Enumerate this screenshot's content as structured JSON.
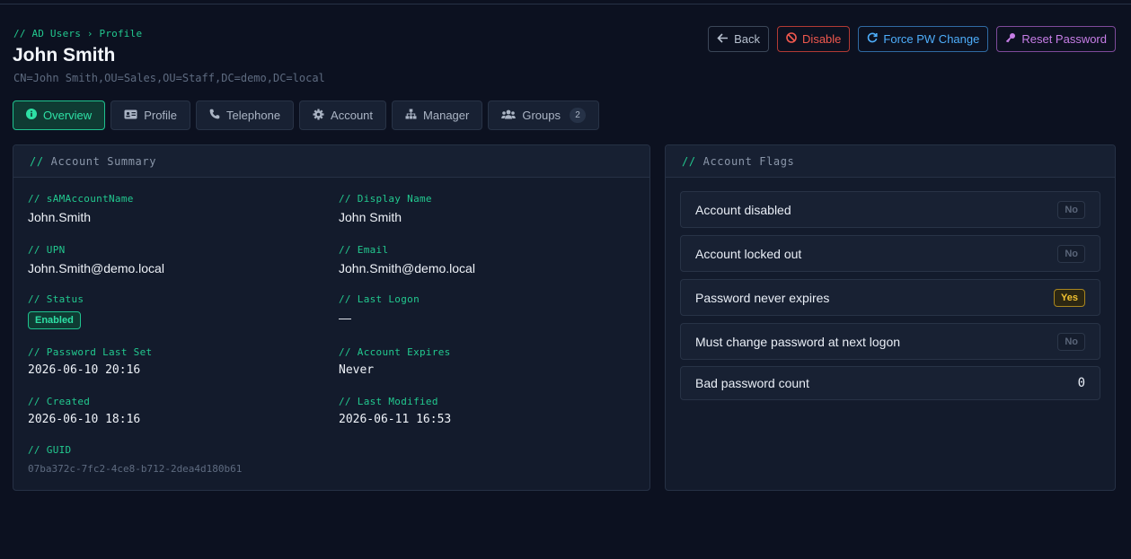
{
  "header": {
    "breadcrumb": "// AD Users › Profile",
    "title": "John Smith",
    "dn": "CN=John Smith,OU=Sales,OU=Staff,DC=demo,DC=local"
  },
  "actions": {
    "back": "Back",
    "disable": "Disable",
    "force_pw": "Force PW Change",
    "reset_pw": "Reset Password"
  },
  "tabs": [
    {
      "label": "Overview",
      "icon": "info-icon"
    },
    {
      "label": "Profile",
      "icon": "id-card-icon"
    },
    {
      "label": "Telephone",
      "icon": "phone-icon"
    },
    {
      "label": "Account",
      "icon": "gear-icon"
    },
    {
      "label": "Manager",
      "icon": "org-chart-icon"
    },
    {
      "label": "Groups",
      "icon": "users-icon",
      "count": "2"
    }
  ],
  "summary": {
    "heading_prefix": "//",
    "heading": "Account Summary",
    "sam_label": "// sAMAccountName",
    "sam_value": "John.Smith",
    "display_label": "// Display Name",
    "display_value": "John Smith",
    "upn_label": "// UPN",
    "upn_value": "John.Smith@demo.local",
    "email_label": "// Email",
    "email_value": "John.Smith@demo.local",
    "status_label": "// Status",
    "status_value": "Enabled",
    "lastlogon_label": "// Last Logon",
    "lastlogon_value": "—",
    "pwlastset_label": "// Password Last Set",
    "pwlastset_value": "2026-06-10 20:16",
    "expires_label": "// Account Expires",
    "expires_value": "Never",
    "created_label": "// Created",
    "created_value": "2026-06-10 18:16",
    "modified_label": "// Last Modified",
    "modified_value": "2026-06-11 16:53",
    "guid_label": "// GUID",
    "guid_value": "07ba372c-7fc2-4ce8-b712-2dea4d180b61"
  },
  "flags": {
    "heading_prefix": "//",
    "heading": "Account Flags",
    "rows": [
      {
        "label": "Account disabled",
        "value": "No"
      },
      {
        "label": "Account locked out",
        "value": "No"
      },
      {
        "label": "Password never expires",
        "value": "Yes"
      },
      {
        "label": "Must change password at next logon",
        "value": "No"
      },
      {
        "label": "Bad password count",
        "value": "0"
      }
    ]
  },
  "colors": {
    "accent_green": "#22c98f",
    "danger_red": "#f0584e",
    "info_blue": "#4eaefb",
    "purple": "#c77ee7",
    "warning_yellow": "#f2c230",
    "background": "#0c1120"
  }
}
